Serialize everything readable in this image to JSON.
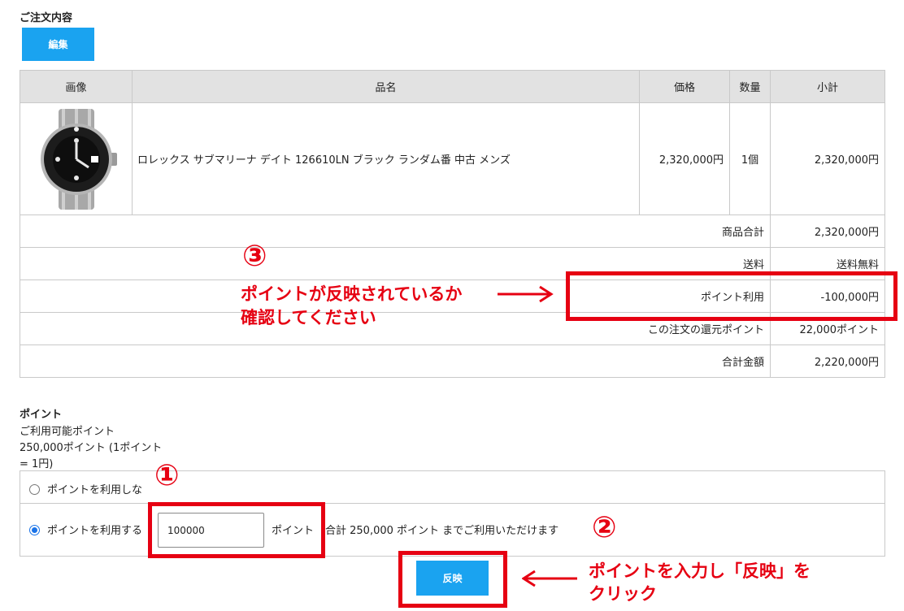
{
  "order": {
    "title": "ご注文内容",
    "edit_label": "編集",
    "headers": [
      "画像",
      "品名",
      "価格",
      "数量",
      "小計"
    ],
    "item": {
      "name": "ロレックス サブマリーナ デイト 126610LN ブラック ランダム番 中古 メンズ",
      "price": "2,320,000円",
      "qty": "1個",
      "subtotal": "2,320,000円"
    },
    "summary": [
      {
        "label": "商品合計",
        "value": "2,320,000円"
      },
      {
        "label": "送料",
        "value": "送料無料"
      },
      {
        "label": "ポイント利用",
        "value": "-100,000円"
      },
      {
        "label": "この注文の還元ポイント",
        "value": "22,000ポイント"
      },
      {
        "label": "合計金額",
        "value": "2,220,000円"
      }
    ]
  },
  "points": {
    "title": "ポイント",
    "available_label": "ご利用可能ポイント",
    "available_value": "250,000ポイント (1ポイント = 1円)",
    "option_no": "ポイントを利用しな",
    "option_yes": "ポイントを利用する",
    "input_value": "100000",
    "unit": "ポイント",
    "note": "合計 250,000 ポイント までご利用いただけます",
    "reflect_label": "反映"
  },
  "annotations": {
    "step1": "①",
    "step2": "②",
    "step3": "③",
    "msg3_line1": "ポイントが反映されているか",
    "msg3_line2": "確認してください",
    "msg2_line1": "ポイントを入力し「反映」を",
    "msg2_line2": "クリック"
  },
  "colors": {
    "accent": "#1aa3f0",
    "annotation": "#e60012",
    "header_bg": "#e2e2e2"
  }
}
